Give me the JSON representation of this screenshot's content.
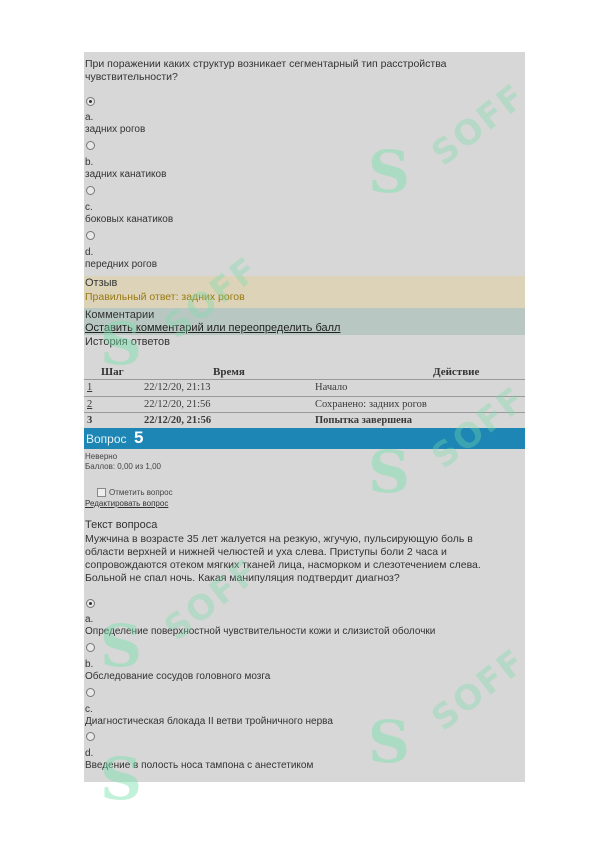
{
  "q4": {
    "text_line1": "При поражении каких структур возникает сегментарный тип расстройства",
    "text_line2": "чувствительности?",
    "options": [
      {
        "letter": "a.",
        "text": "задних рогов",
        "checked": true
      },
      {
        "letter": "b.",
        "text": "задних канатиков",
        "checked": false
      },
      {
        "letter": "c.",
        "text": "боковых канатиков",
        "checked": false
      },
      {
        "letter": "d.",
        "text": "передних рогов",
        "checked": false
      }
    ],
    "feedback_label": "Отзыв",
    "feedback_text": "Правильный ответ: задних рогов",
    "comments_label": "Комментарии",
    "comments_link": "Оставить комментарий или переопределить балл",
    "history_label": "История ответов"
  },
  "history": {
    "headers": [
      "Шаг",
      "Время",
      "Действие"
    ],
    "rows": [
      {
        "step": "1",
        "time": "22/12/20, 21:13",
        "action": "Начало"
      },
      {
        "step": "2",
        "time": "22/12/20, 21:56",
        "action": "Сохранено: задних рогов"
      },
      {
        "step": "3",
        "time": "22/12/20, 21:56",
        "action": "Попытка завершена"
      }
    ]
  },
  "q5": {
    "label": "Вопрос",
    "number": "5",
    "status": "Неверно",
    "score": "Баллов: 0,00 из 1,00",
    "flag": "Отметить вопрос",
    "edit": "Редактировать вопрос",
    "text_heading": "Текст вопроса",
    "text_lines": [
      "Мужчина в возрасте 35 лет жалуется на резкую, жгучую, пульсирующую боль в",
      "области верхней и нижней челюстей и уха слева. Приступы боли 2 часа и",
      "сопровождаются отеком мягких тканей лица, насморком и слезотечением слева.",
      "Больной не спал ночь. Какая манипуляция подтвердит диагноз?"
    ],
    "options": [
      {
        "letter": "a.",
        "text": "Определение поверхностной чувствительности кожи и слизистой оболочки",
        "checked": true
      },
      {
        "letter": "b.",
        "text": "Обследование сосудов головного мозга",
        "checked": false
      },
      {
        "letter": "c.",
        "text": "Диагностическая блокада II ветви тройничного нерва",
        "checked": false
      },
      {
        "letter": "d.",
        "text": "Введение в полость носа тампона с анестетиком",
        "checked": false
      }
    ]
  },
  "watermark": {
    "text": "SOFF",
    "logo": "S"
  },
  "colors": {
    "panel": "#d7d7d7",
    "feedback": "#dcd3b8",
    "comments": "#b9c7c3",
    "question_bar": "#1d86b4",
    "feedback_text": "#9a7a10"
  }
}
